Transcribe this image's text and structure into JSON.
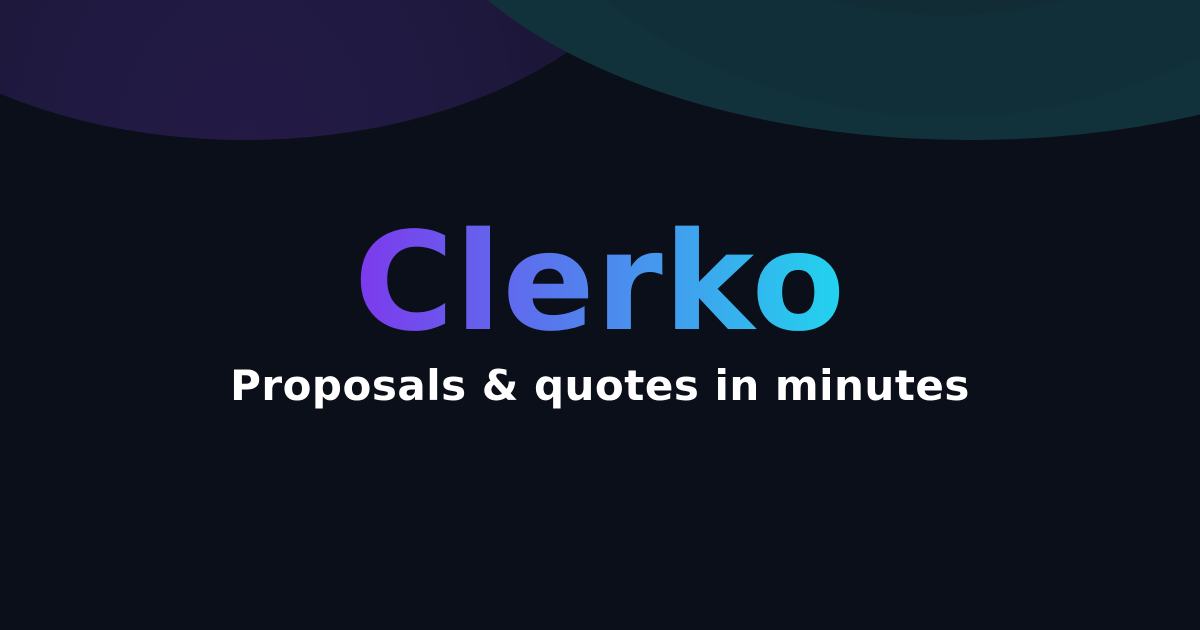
{
  "brand": {
    "name": "Clerko",
    "gradient_start": "#7c3aed",
    "gradient_end": "#22d3ee"
  },
  "tagline": "Proposals & quotes in minutes",
  "colors": {
    "background": "#0b0f19",
    "purple_blob": "#231a45",
    "teal_blob": "#12323b",
    "text": "#ffffff"
  }
}
